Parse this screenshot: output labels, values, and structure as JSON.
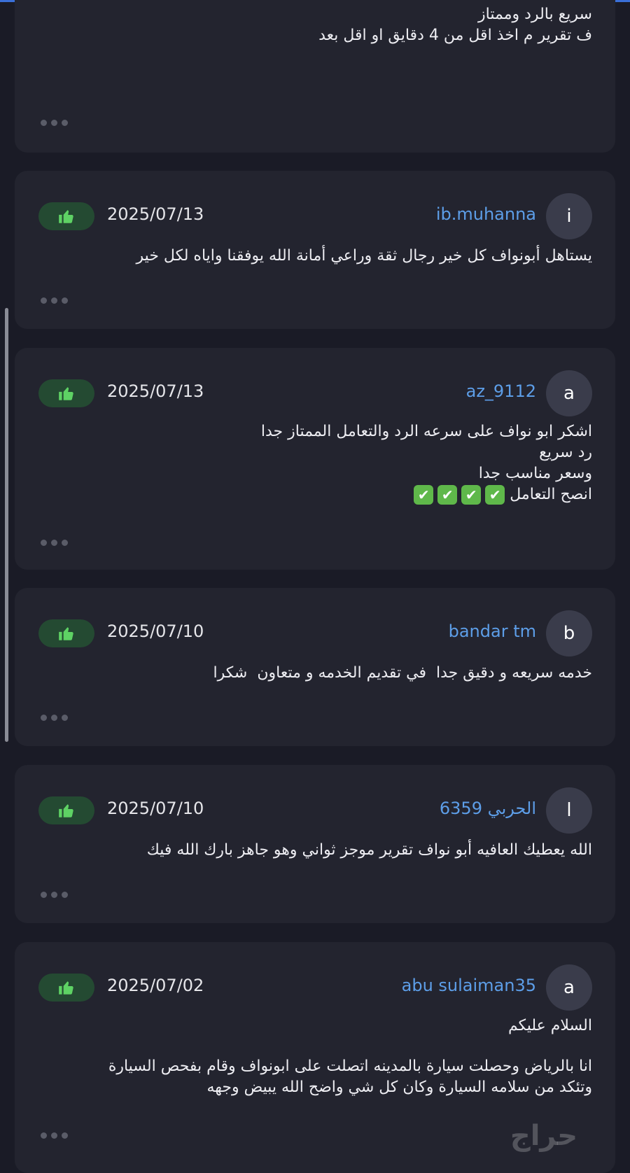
{
  "colors": {
    "accent": "#5d9ee8",
    "like_bg": "#244a32",
    "like_icon": "#5ed264",
    "card_bg": "#23242f",
    "page_bg": "#1a1b26"
  },
  "reviews": [
    {
      "lines": [
        "سريع بالرد وممتاز",
        "ف تقرير م اخذ اقل من 4 دقايق او اقل بعد"
      ]
    },
    {
      "avatar": "i",
      "username": "ib.muhanna",
      "date": "2025/07/13",
      "lines": [
        "يستاهل أبونواف كل خير رجال ثقة وراعي أمانة الله يوفقنا واياه لكل خير"
      ]
    },
    {
      "avatar": "a",
      "username": "az_9112",
      "date": "2025/07/13",
      "lines": [
        "اشكر ابو نواف على سرعه الرد والتعامل الممتاز جدا",
        "رد سريع",
        "وسعر مناسب جدا",
        "انصح التعامل"
      ],
      "checks": [
        "✔",
        "✔",
        "✔",
        "✔"
      ]
    },
    {
      "avatar": "b",
      "username": "bandar tm",
      "date": "2025/07/10",
      "lines": [
        "خدمه سريعه و دقيق جدا  في تقديم الخدمه و متعاون  شكرا"
      ]
    },
    {
      "avatar": "ا",
      "username": "الحربي 6359",
      "date": "2025/07/10",
      "lines": [
        "الله يعطيك العافيه أبو نواف تقرير موجز ثواني وهو جاهز بارك الله فيك"
      ]
    },
    {
      "avatar": "a",
      "username": "abu sulaiman35",
      "date": "2025/07/02",
      "lines": [
        "السلام عليكم",
        "انا بالرياض وحصلت سيارة بالمدينه اتصلت على ابونواف وقام بفحص السيارة",
        "وتئكد من سلامه السيارة وكان كل شي واضح الله يبيض وجهه"
      ]
    }
  ],
  "watermark": {
    "text": "حراج"
  },
  "icons": {
    "like": "thumbs-up-icon",
    "more": "more-dots-icon"
  }
}
